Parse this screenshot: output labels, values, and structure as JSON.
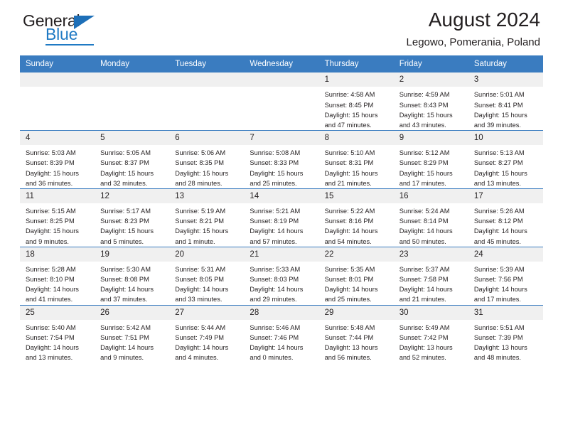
{
  "brand": {
    "name_top": "General",
    "name_bottom": "Blue",
    "accent_color": "#1f7ac4"
  },
  "header": {
    "title": "August 2024",
    "subtitle": "Legowo, Pomerania, Poland"
  },
  "theme": {
    "header_row_bg": "#3a7cc0",
    "daynum_bg": "#f0f0f0",
    "text_color": "#231f20"
  },
  "weekday_headers": [
    "Sunday",
    "Monday",
    "Tuesday",
    "Wednesday",
    "Thursday",
    "Friday",
    "Saturday"
  ],
  "labels": {
    "sunrise_prefix": "Sunrise:",
    "sunset_prefix": "Sunset:",
    "daylight_prefix": "Daylight:"
  },
  "weeks": [
    [
      {
        "day": "",
        "sunrise": "",
        "sunset": "",
        "daylight": "",
        "empty": true
      },
      {
        "day": "",
        "sunrise": "",
        "sunset": "",
        "daylight": "",
        "empty": true
      },
      {
        "day": "",
        "sunrise": "",
        "sunset": "",
        "daylight": "",
        "empty": true
      },
      {
        "day": "",
        "sunrise": "",
        "sunset": "",
        "daylight": "",
        "empty": true
      },
      {
        "day": "1",
        "sunrise": "Sunrise: 4:58 AM",
        "sunset": "Sunset: 8:45 PM",
        "daylight": "Daylight: 15 hours and 47 minutes."
      },
      {
        "day": "2",
        "sunrise": "Sunrise: 4:59 AM",
        "sunset": "Sunset: 8:43 PM",
        "daylight": "Daylight: 15 hours and 43 minutes."
      },
      {
        "day": "3",
        "sunrise": "Sunrise: 5:01 AM",
        "sunset": "Sunset: 8:41 PM",
        "daylight": "Daylight: 15 hours and 39 minutes."
      }
    ],
    [
      {
        "day": "4",
        "sunrise": "Sunrise: 5:03 AM",
        "sunset": "Sunset: 8:39 PM",
        "daylight": "Daylight: 15 hours and 36 minutes."
      },
      {
        "day": "5",
        "sunrise": "Sunrise: 5:05 AM",
        "sunset": "Sunset: 8:37 PM",
        "daylight": "Daylight: 15 hours and 32 minutes."
      },
      {
        "day": "6",
        "sunrise": "Sunrise: 5:06 AM",
        "sunset": "Sunset: 8:35 PM",
        "daylight": "Daylight: 15 hours and 28 minutes."
      },
      {
        "day": "7",
        "sunrise": "Sunrise: 5:08 AM",
        "sunset": "Sunset: 8:33 PM",
        "daylight": "Daylight: 15 hours and 25 minutes."
      },
      {
        "day": "8",
        "sunrise": "Sunrise: 5:10 AM",
        "sunset": "Sunset: 8:31 PM",
        "daylight": "Daylight: 15 hours and 21 minutes."
      },
      {
        "day": "9",
        "sunrise": "Sunrise: 5:12 AM",
        "sunset": "Sunset: 8:29 PM",
        "daylight": "Daylight: 15 hours and 17 minutes."
      },
      {
        "day": "10",
        "sunrise": "Sunrise: 5:13 AM",
        "sunset": "Sunset: 8:27 PM",
        "daylight": "Daylight: 15 hours and 13 minutes."
      }
    ],
    [
      {
        "day": "11",
        "sunrise": "Sunrise: 5:15 AM",
        "sunset": "Sunset: 8:25 PM",
        "daylight": "Daylight: 15 hours and 9 minutes."
      },
      {
        "day": "12",
        "sunrise": "Sunrise: 5:17 AM",
        "sunset": "Sunset: 8:23 PM",
        "daylight": "Daylight: 15 hours and 5 minutes."
      },
      {
        "day": "13",
        "sunrise": "Sunrise: 5:19 AM",
        "sunset": "Sunset: 8:21 PM",
        "daylight": "Daylight: 15 hours and 1 minute."
      },
      {
        "day": "14",
        "sunrise": "Sunrise: 5:21 AM",
        "sunset": "Sunset: 8:19 PM",
        "daylight": "Daylight: 14 hours and 57 minutes."
      },
      {
        "day": "15",
        "sunrise": "Sunrise: 5:22 AM",
        "sunset": "Sunset: 8:16 PM",
        "daylight": "Daylight: 14 hours and 54 minutes."
      },
      {
        "day": "16",
        "sunrise": "Sunrise: 5:24 AM",
        "sunset": "Sunset: 8:14 PM",
        "daylight": "Daylight: 14 hours and 50 minutes."
      },
      {
        "day": "17",
        "sunrise": "Sunrise: 5:26 AM",
        "sunset": "Sunset: 8:12 PM",
        "daylight": "Daylight: 14 hours and 45 minutes."
      }
    ],
    [
      {
        "day": "18",
        "sunrise": "Sunrise: 5:28 AM",
        "sunset": "Sunset: 8:10 PM",
        "daylight": "Daylight: 14 hours and 41 minutes."
      },
      {
        "day": "19",
        "sunrise": "Sunrise: 5:30 AM",
        "sunset": "Sunset: 8:08 PM",
        "daylight": "Daylight: 14 hours and 37 minutes."
      },
      {
        "day": "20",
        "sunrise": "Sunrise: 5:31 AM",
        "sunset": "Sunset: 8:05 PM",
        "daylight": "Daylight: 14 hours and 33 minutes."
      },
      {
        "day": "21",
        "sunrise": "Sunrise: 5:33 AM",
        "sunset": "Sunset: 8:03 PM",
        "daylight": "Daylight: 14 hours and 29 minutes."
      },
      {
        "day": "22",
        "sunrise": "Sunrise: 5:35 AM",
        "sunset": "Sunset: 8:01 PM",
        "daylight": "Daylight: 14 hours and 25 minutes."
      },
      {
        "day": "23",
        "sunrise": "Sunrise: 5:37 AM",
        "sunset": "Sunset: 7:58 PM",
        "daylight": "Daylight: 14 hours and 21 minutes."
      },
      {
        "day": "24",
        "sunrise": "Sunrise: 5:39 AM",
        "sunset": "Sunset: 7:56 PM",
        "daylight": "Daylight: 14 hours and 17 minutes."
      }
    ],
    [
      {
        "day": "25",
        "sunrise": "Sunrise: 5:40 AM",
        "sunset": "Sunset: 7:54 PM",
        "daylight": "Daylight: 14 hours and 13 minutes."
      },
      {
        "day": "26",
        "sunrise": "Sunrise: 5:42 AM",
        "sunset": "Sunset: 7:51 PM",
        "daylight": "Daylight: 14 hours and 9 minutes."
      },
      {
        "day": "27",
        "sunrise": "Sunrise: 5:44 AM",
        "sunset": "Sunset: 7:49 PM",
        "daylight": "Daylight: 14 hours and 4 minutes."
      },
      {
        "day": "28",
        "sunrise": "Sunrise: 5:46 AM",
        "sunset": "Sunset: 7:46 PM",
        "daylight": "Daylight: 14 hours and 0 minutes."
      },
      {
        "day": "29",
        "sunrise": "Sunrise: 5:48 AM",
        "sunset": "Sunset: 7:44 PM",
        "daylight": "Daylight: 13 hours and 56 minutes."
      },
      {
        "day": "30",
        "sunrise": "Sunrise: 5:49 AM",
        "sunset": "Sunset: 7:42 PM",
        "daylight": "Daylight: 13 hours and 52 minutes."
      },
      {
        "day": "31",
        "sunrise": "Sunrise: 5:51 AM",
        "sunset": "Sunset: 7:39 PM",
        "daylight": "Daylight: 13 hours and 48 minutes."
      }
    ]
  ]
}
